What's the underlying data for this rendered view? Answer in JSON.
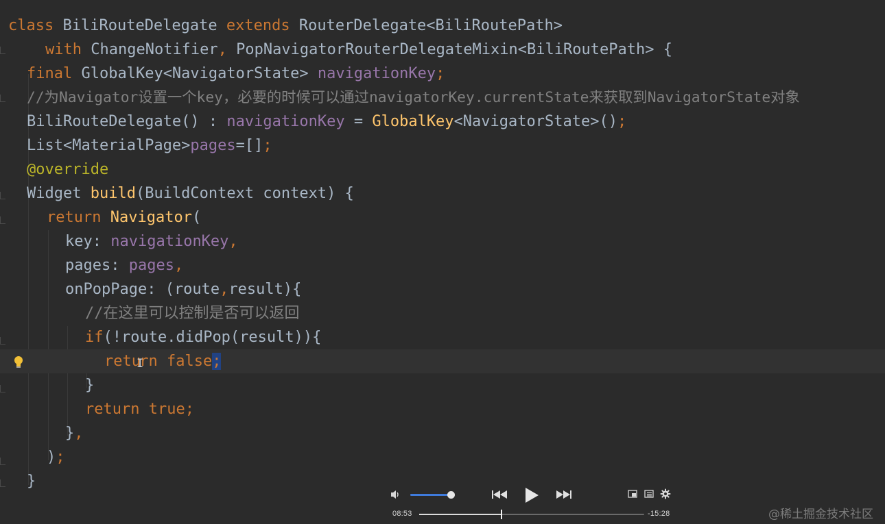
{
  "code": {
    "line1": {
      "kw1": "class",
      "name": "BiliRouteDelegate",
      "kw2": "extends",
      "type": "RouterDelegate<BiliRoutePath>"
    },
    "line2": {
      "kw": "with",
      "types": "ChangeNotifier",
      "sep": ",",
      "mixin": "PopNavigatorRouterDelegateMixin<BiliRoutePath>",
      "brace": "{"
    },
    "line3": {
      "kw": "final",
      "type": "GlobalKey<NavigatorState>",
      "field": "navigationKey",
      "semi": ";"
    },
    "line4": {
      "comment": "//为Navigator设置一个key，必要的时候可以通过navigatorKey.currentState来获取到NavigatorState对象"
    },
    "line5": {
      "ctor": "BiliRouteDelegate() : ",
      "field": "navigationKey",
      "eq": " = ",
      "fn": "GlobalKey",
      "rest": "<NavigatorState>()",
      "semi": ";"
    },
    "line6": {
      "type": "List<MaterialPage>",
      "field": "pages",
      "rest": "=[]",
      "semi": ";"
    },
    "line7": {
      "annotation": "@override"
    },
    "line8": {
      "type": "Widget ",
      "fn": "build",
      "rest": "(BuildContext context) {"
    },
    "line9": {
      "kw": "return",
      "fn": "Navigator",
      "rest": "("
    },
    "line10": {
      "param": "key: ",
      "field": "navigationKey",
      "comma": ","
    },
    "line11": {
      "param": "pages: ",
      "field": "pages",
      "comma": ","
    },
    "line12": {
      "param": "onPopPage: (route",
      "comma": ",",
      "rest": "result){"
    },
    "line13": {
      "comment": "//在这里可以控制是否可以返回"
    },
    "line14": {
      "kw": "if",
      "rest": "(!route.didPop(result)){"
    },
    "line15": {
      "kw1": "retu",
      "cursor": "I",
      "kw1b": "rn",
      "kw2": "false",
      "semi": ";"
    },
    "line16": {
      "text": "}"
    },
    "line17": {
      "kw1": "return",
      "kw2": "true",
      "semi": ";"
    },
    "line18": {
      "text": "}",
      "comma": ","
    },
    "line19": {
      "text": ")",
      "semi": ";"
    },
    "line20": {
      "text": "}"
    }
  },
  "player": {
    "volume_icon": "volume-icon",
    "volume_level": 0.95,
    "prev_icon": "rewind-icon",
    "play_icon": "play-icon",
    "next_icon": "fast-forward-icon",
    "pip_icon": "picture-in-picture-icon",
    "list_icon": "playlist-icon",
    "settings_icon": "gear-icon",
    "elapsed": "08:53",
    "remaining": "-15:28",
    "progress": 0.366
  },
  "watermark": "@稀土掘金技术社区",
  "colors": {
    "background": "#2b2b2b",
    "keyword": "#cc7832",
    "identifier": "#a9b7c6",
    "field": "#9876aa",
    "function": "#ffc66d",
    "comment": "#808080",
    "annotation": "#bbb529",
    "accent": "#3f7bdc"
  }
}
